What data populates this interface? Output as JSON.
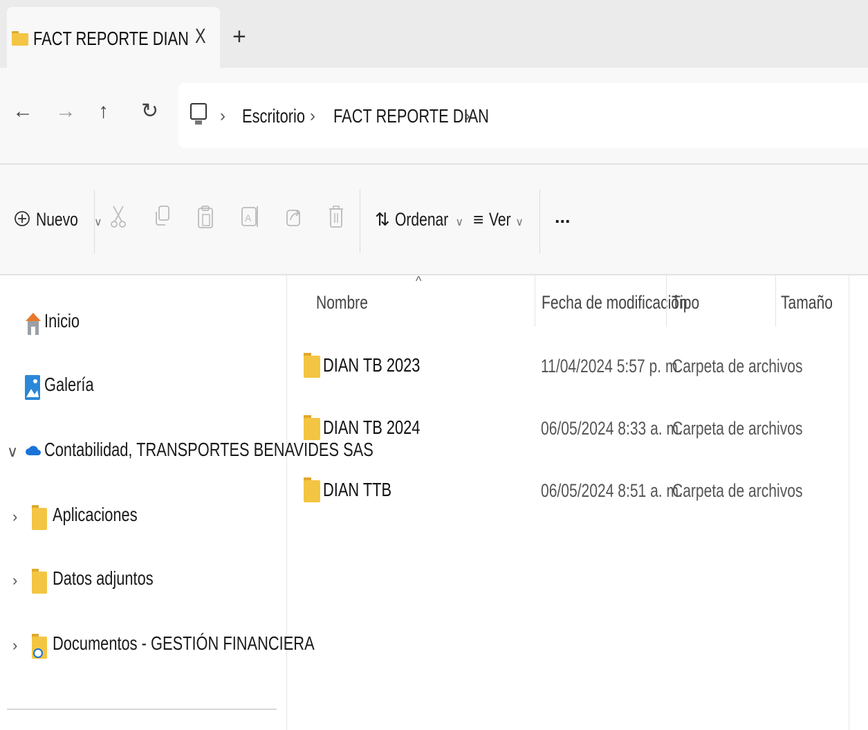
{
  "tab": {
    "title": "FACT REPORTE DIAN",
    "close": "X",
    "new": "+"
  },
  "address": {
    "segments": [
      "Escritorio",
      "FACT REPORTE DIAN"
    ]
  },
  "toolbar": {
    "new_label": "Nuevo",
    "sort_label": "Ordenar",
    "view_label": "Ver",
    "more_label": "..."
  },
  "nav": {
    "home": "Inicio",
    "gallery": "Galería",
    "onedrive": "Contabilidad, TRANSPORTES BENAVIDES SAS",
    "children": [
      "Aplicaciones",
      "Datos adjuntos",
      "Documentos - GESTIÓN FINANCIERA"
    ]
  },
  "columns": {
    "name": "Nombre",
    "modified": "Fecha de modificación",
    "type": "Tipo",
    "size": "Tamaño"
  },
  "files": [
    {
      "name": "DIAN TB 2023",
      "modified": "11/04/2024 5:57 p. m.",
      "type": "Carpeta de archivos"
    },
    {
      "name": "DIAN TB 2024",
      "modified": "06/05/2024 8:33 a. m.",
      "type": "Carpeta de archivos"
    },
    {
      "name": "DIAN TTB",
      "modified": "06/05/2024 8:51 a. m.",
      "type": "Carpeta de archivos"
    }
  ],
  "colors": {
    "folder": "#f4c542",
    "folder_dark": "#e0a82e",
    "onedrive": "#1a73d9"
  },
  "icons": [
    "folder-icon",
    "back-arrow-icon",
    "forward-arrow-icon",
    "up-arrow-icon",
    "refresh-icon",
    "this-pc-icon",
    "plus-circle-icon",
    "cut-icon",
    "copy-icon",
    "paste-icon",
    "rename-icon",
    "share-icon",
    "delete-icon",
    "sort-icon",
    "view-icon",
    "home-icon",
    "gallery-icon",
    "onedrive-cloud-icon",
    "chevron-right-icon",
    "chevron-down-icon"
  ]
}
